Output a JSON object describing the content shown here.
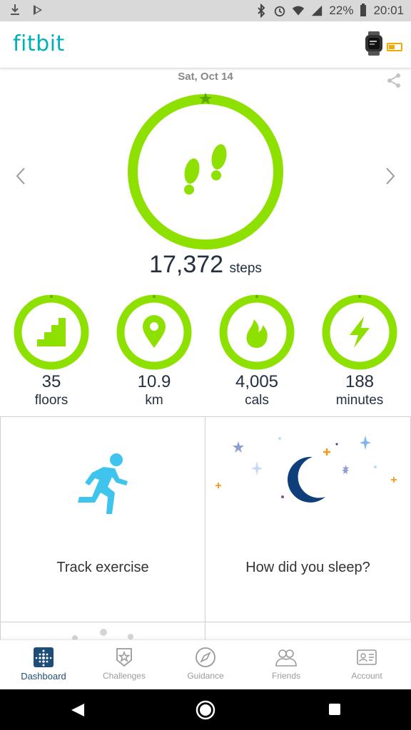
{
  "status_bar": {
    "battery_percent": "22%",
    "time": "20:01",
    "left_icons": [
      "download-icon",
      "play-store-icon"
    ],
    "right_icons": [
      "bluetooth-icon",
      "alarm-icon",
      "wifi-icon",
      "signal-icon",
      "battery-icon"
    ]
  },
  "header": {
    "brand": "fitbit",
    "device_icon": "watch-icon",
    "device_battery_icon": "battery-low-icon"
  },
  "summary": {
    "date": "Sat, Oct 14",
    "steps_value": "17,372",
    "steps_unit": "steps",
    "steps_goal_progress": 1.0,
    "accent_color": "#8ee000"
  },
  "stats": [
    {
      "id": "floors",
      "value": "35",
      "label": "floors",
      "icon": "stairs-icon"
    },
    {
      "id": "distance",
      "value": "10.9",
      "label": "km",
      "icon": "location-pin-icon"
    },
    {
      "id": "calories",
      "value": "4,005",
      "label": "cals",
      "icon": "flame-icon"
    },
    {
      "id": "active",
      "value": "188",
      "label": "minutes",
      "icon": "lightning-icon"
    }
  ],
  "tiles": {
    "exercise_label": "Track exercise",
    "sleep_label": "How did you sleep?"
  },
  "tabs": [
    {
      "label": "Dashboard",
      "icon": "dashboard-icon",
      "active": true
    },
    {
      "label": "Challenges",
      "icon": "star-badge-icon",
      "active": false
    },
    {
      "label": "Guidance",
      "icon": "compass-icon",
      "active": false
    },
    {
      "label": "Friends",
      "icon": "friends-icon",
      "active": false
    },
    {
      "label": "Account",
      "icon": "account-card-icon",
      "active": false
    }
  ],
  "colors": {
    "brand": "#00b0b9",
    "ring": "#8ee000",
    "runner": "#3fc4ee",
    "moon": "#0e3f7a",
    "tab_active": "#1e4d78"
  }
}
